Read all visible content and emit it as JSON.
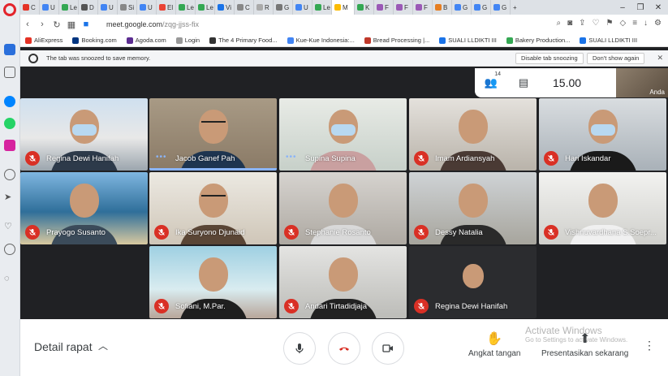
{
  "browser": {
    "tabs": [
      "C",
      "U",
      "Le",
      "D",
      "U",
      "Si",
      "U",
      "El",
      "Le",
      "Le",
      "Vi",
      "C",
      "R",
      "G",
      "U",
      "Le",
      "M",
      "K",
      "F",
      "F",
      "F",
      "B",
      "G",
      "G",
      "G"
    ],
    "active_tab": "M",
    "new_tab": "+",
    "url_prefix": "meet.google.com",
    "url_path": "/zqg-jjss-fix",
    "window_controls": {
      "minimize": "–",
      "maximize": "❐",
      "close": "✕"
    }
  },
  "bookmarks": [
    {
      "label": "AliExpress",
      "color": "#e43225"
    },
    {
      "label": "Booking.com",
      "color": "#003580"
    },
    {
      "label": "Agoda.com",
      "color": "#5c2d91"
    },
    {
      "label": "Login",
      "color": "#999999"
    },
    {
      "label": "The 4 Primary Food...",
      "color": "#333333"
    },
    {
      "label": "Kue-Kue Indonesia:...",
      "color": "#4285f4"
    },
    {
      "label": "Bread Processing |...",
      "color": "#c0392b"
    },
    {
      "label": "SUALI LLDIKTI III",
      "color": "#1a73e8"
    },
    {
      "label": "Bakery Production...",
      "color": "#34a853"
    },
    {
      "label": "SUALI LLDIKTI III",
      "color": "#1a73e8"
    }
  ],
  "snooze": {
    "message": "The tab was snoozed to save memory.",
    "disable_btn": "Disable tab snoozing",
    "dont_show_btn": "Don't show again"
  },
  "meet": {
    "participant_count": "14",
    "time": "15.00",
    "self_label": "Anda",
    "participants": [
      {
        "name": "Regina Dewi Hanifah",
        "muted": true
      },
      {
        "name": "Jacob Ganef Pah",
        "muted": false
      },
      {
        "name": "Supina Supina",
        "muted": false
      },
      {
        "name": "Imam Ardiansyah",
        "muted": true
      },
      {
        "name": "Hari Iskandar",
        "muted": true
      },
      {
        "name": "Prayogo Susanto",
        "muted": true
      },
      {
        "name": "Ika Suryono Djunaid",
        "muted": true
      },
      {
        "name": "Stephanie Rosanto",
        "muted": true
      },
      {
        "name": "Dessy Natalia",
        "muted": true
      },
      {
        "name": "Vishnuvardhana S.Soepr...",
        "muted": true
      },
      {
        "name": "Sofiani, M.Par.",
        "muted": true
      },
      {
        "name": "Andari Tirtadidjaja",
        "muted": true
      },
      {
        "name": "Regina Dewi Hanifah",
        "muted": true
      }
    ],
    "bottom": {
      "detail_label": "Detail rapat",
      "raise_hand": "Angkat tangan",
      "present_now": "Presentasikan sekarang",
      "watermark_title": "Activate Windows",
      "watermark_sub": "Go to Settings to activate Windows."
    }
  }
}
